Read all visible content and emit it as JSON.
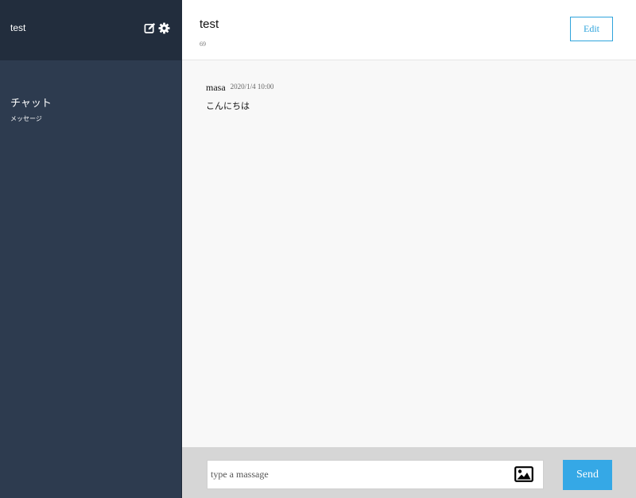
{
  "sidebar": {
    "user_name": "test",
    "header_icons": [
      "edit-icon",
      "gear-icon"
    ],
    "rooms": [
      {
        "name": "チャット",
        "description": "メッセージ"
      }
    ]
  },
  "room": {
    "title": "test",
    "count": "69",
    "edit_label": "Edit"
  },
  "messages": [
    {
      "user": "masa",
      "time": "2020/1/4 10:00",
      "text": "こんにちは"
    }
  ],
  "composer": {
    "placeholder": "type a massage",
    "value": "",
    "image_icon": "image-icon",
    "send_label": "Send"
  },
  "colors": {
    "sidebar_bg": "#2d3b4f",
    "sidebar_header_bg": "#222d3d",
    "accent": "#35a8e6"
  }
}
